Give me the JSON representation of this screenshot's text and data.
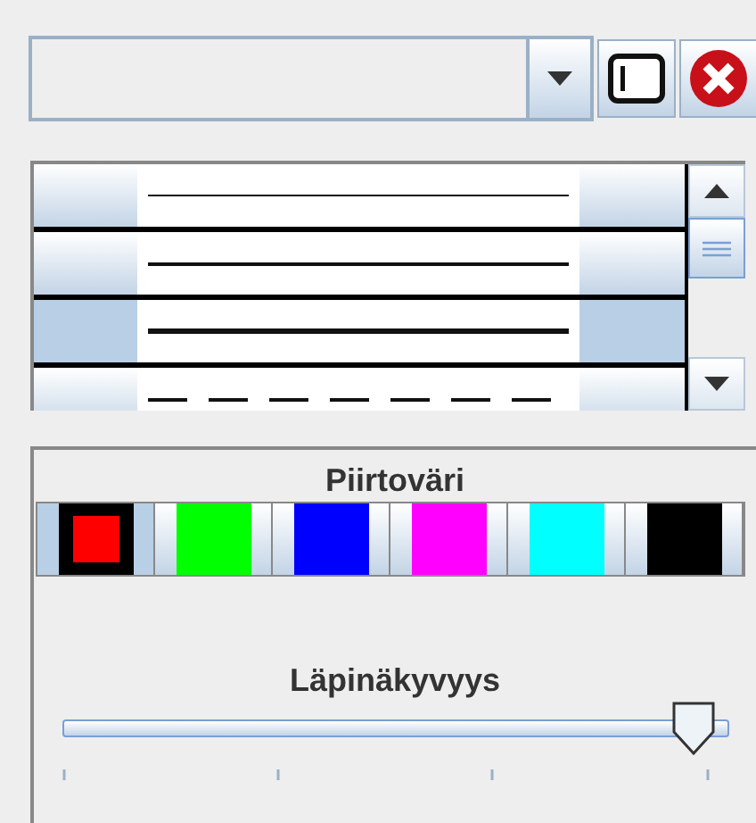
{
  "line_styles": [
    {
      "kind": "thin",
      "selected": false
    },
    {
      "kind": "medium",
      "selected": false
    },
    {
      "kind": "thick",
      "selected": true
    },
    {
      "kind": "dashed",
      "selected": false
    }
  ],
  "color_panel": {
    "title": "Piirtoväri",
    "colors": [
      {
        "color": "#ff0000",
        "selected": true
      },
      {
        "color": "#00ff00",
        "selected": false
      },
      {
        "color": "#0000ff",
        "selected": false
      },
      {
        "color": "#ff00ff",
        "selected": false
      },
      {
        "color": "#00ffff",
        "selected": false
      },
      {
        "color": "#000000",
        "selected": false
      }
    ]
  },
  "opacity": {
    "label": "Läpinäkyvyys",
    "level": 0.97
  }
}
